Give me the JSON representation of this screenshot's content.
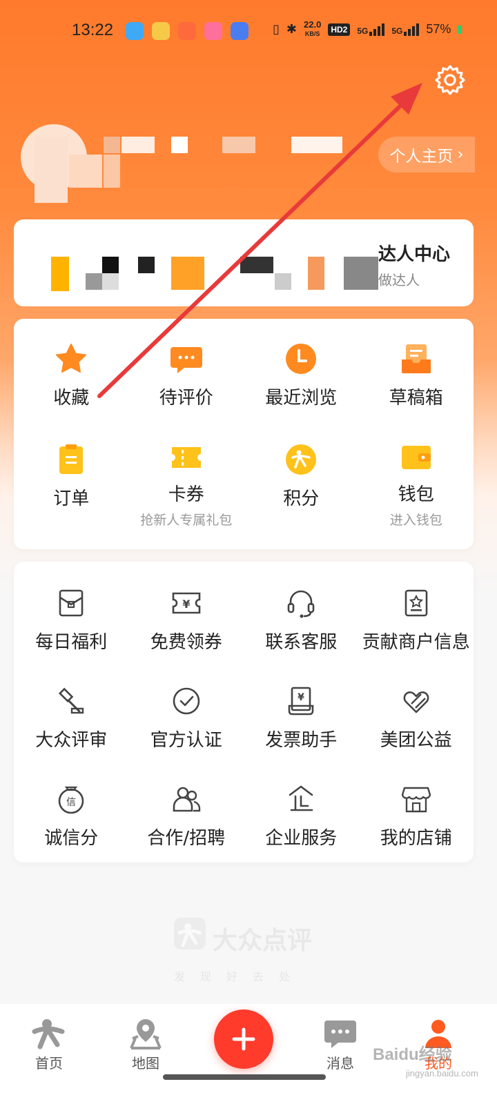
{
  "status_bar": {
    "time": "13:22",
    "net_speed": "22.0",
    "net_unit": "KB/S",
    "hd": "HD2",
    "sig1": "5G",
    "sig2": "5G",
    "battery": "57%"
  },
  "header": {
    "homepage_label": "个人主页",
    "settings_icon": "gear-icon"
  },
  "talent": {
    "title": "达人中心",
    "subtitle": "做达人"
  },
  "main_grid": [
    {
      "label": "收藏",
      "sub": "",
      "icon": "star-icon"
    },
    {
      "label": "待评价",
      "sub": "",
      "icon": "comment-icon"
    },
    {
      "label": "最近浏览",
      "sub": "",
      "icon": "clock-icon"
    },
    {
      "label": "草稿箱",
      "sub": "",
      "icon": "draft-box-icon"
    },
    {
      "label": "订单",
      "sub": "",
      "icon": "order-icon"
    },
    {
      "label": "卡券",
      "sub": "抢新人专属礼包",
      "icon": "ticket-icon"
    },
    {
      "label": "积分",
      "sub": "",
      "icon": "points-icon"
    },
    {
      "label": "钱包",
      "sub": "进入钱包",
      "icon": "wallet-icon"
    }
  ],
  "tools_grid": [
    {
      "label": "每日福利",
      "icon": "red-packet-icon"
    },
    {
      "label": "免费领券",
      "icon": "coupon-icon"
    },
    {
      "label": "联系客服",
      "icon": "headset-icon"
    },
    {
      "label": "贡献商户信息",
      "icon": "merchant-info-icon"
    },
    {
      "label": "大众评审",
      "icon": "gavel-icon"
    },
    {
      "label": "官方认证",
      "icon": "check-circle-icon"
    },
    {
      "label": "发票助手",
      "icon": "invoice-icon"
    },
    {
      "label": "美团公益",
      "icon": "charity-icon"
    },
    {
      "label": "诚信分",
      "icon": "credit-icon"
    },
    {
      "label": "合作/招聘",
      "icon": "people-icon"
    },
    {
      "label": "企业服务",
      "icon": "enterprise-icon"
    },
    {
      "label": "我的店铺",
      "icon": "shop-icon"
    }
  ],
  "brand": {
    "name": "大众点评",
    "slogan": "发现好去处"
  },
  "bottom_nav": [
    {
      "label": "首页",
      "icon": "home-icon"
    },
    {
      "label": "地图",
      "icon": "map-pin-icon"
    },
    {
      "label": "消息",
      "icon": "message-icon"
    },
    {
      "label": "我的",
      "icon": "profile-icon"
    }
  ],
  "watermark": {
    "text": "Baidu经验",
    "sub": "jingyan.baidu.com"
  },
  "colors": {
    "accent": "#ff7a2c",
    "plus": "#ff3b2c",
    "arrow": "#e83a3a",
    "icon_orange": "#ff8a1f",
    "icon_yellow": "#ffc21a"
  }
}
